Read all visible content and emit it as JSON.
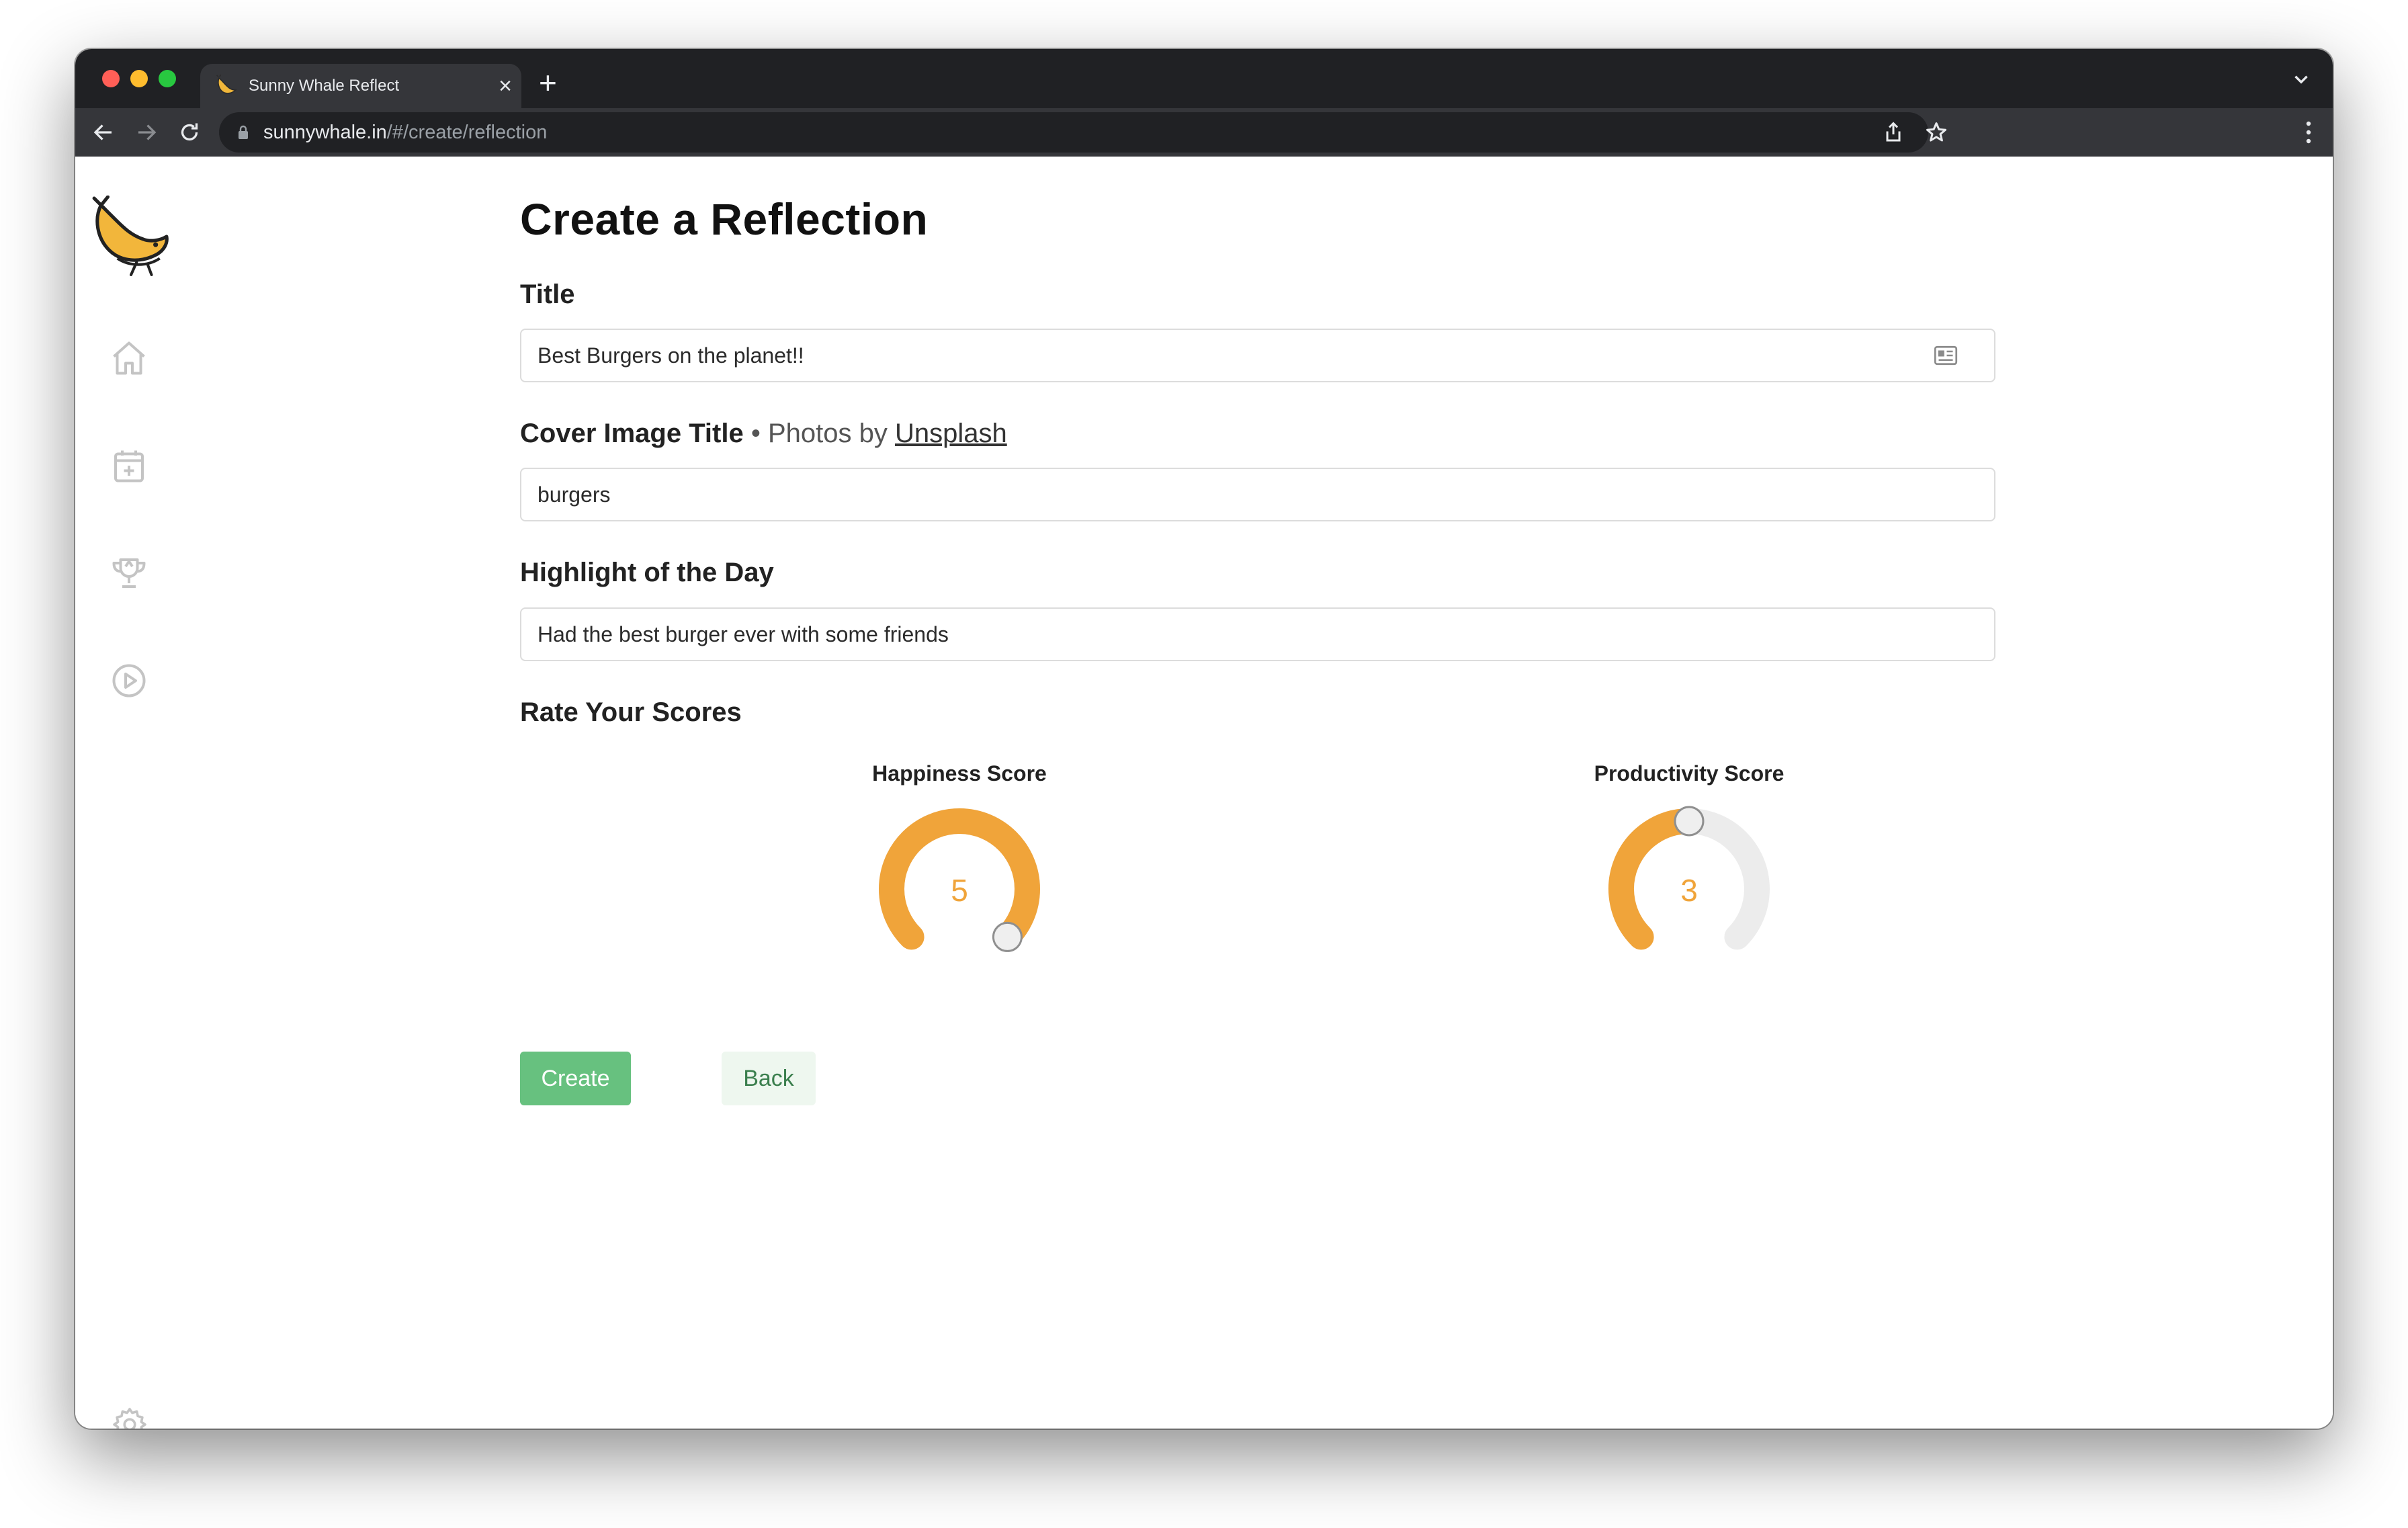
{
  "browser": {
    "tab_title": "Sunny Whale Reflect",
    "tab_close": "×",
    "new_tab": "+",
    "url_host": "sunnywhale.in",
    "url_path": "/#/create/reflection",
    "traffic_lights": {
      "close": "#ff5f57",
      "minimize": "#febc2e",
      "zoom": "#28c840"
    }
  },
  "sidebar": {
    "items": [
      {
        "name": "home",
        "icon": "home-icon"
      },
      {
        "name": "create",
        "icon": "calendar-plus-icon"
      },
      {
        "name": "achievements",
        "icon": "trophy-icon"
      },
      {
        "name": "play",
        "icon": "play-circle-icon"
      }
    ],
    "settings_icon": "gear-icon"
  },
  "page": {
    "title": "Create a Reflection",
    "title_label": "Title",
    "title_value": "Best Burgers on the planet!!",
    "cover_label": "Cover Image Title",
    "cover_note": " • Photos by ",
    "cover_link": "Unsplash",
    "cover_value": "burgers",
    "highlight_label": "Highlight of the Day",
    "highlight_value": "Had the best burger ever with some friends",
    "rate_label": "Rate Your Scores"
  },
  "scores": {
    "happiness": {
      "label": "Happiness Score",
      "value": "5",
      "fraction": 1.0
    },
    "productivity": {
      "label": "Productivity Score",
      "value": "3",
      "fraction": 0.5
    }
  },
  "colors": {
    "accent": "#f0a43a",
    "track": "#ececec",
    "create_button": "#67c17f",
    "back_button_bg": "#eef7ef"
  },
  "actions": {
    "create": "Create",
    "back": "Back"
  }
}
